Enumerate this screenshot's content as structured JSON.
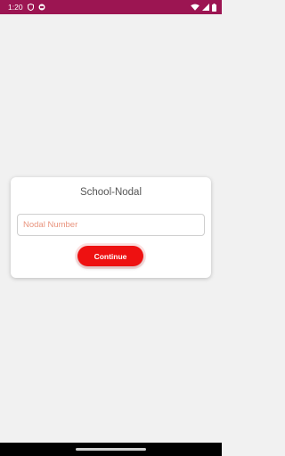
{
  "status_bar": {
    "time": "1:20",
    "left_icons": [
      "shield-icon",
      "notification-app-icon"
    ],
    "right_icons": [
      "wifi-icon",
      "signal-icon",
      "battery-icon"
    ],
    "color": "#9c1552"
  },
  "card": {
    "title": "School-Nodal",
    "input": {
      "placeholder": "Nodal Number",
      "value": ""
    },
    "continue_label": "Continue"
  },
  "colors": {
    "accent": "#ee1111",
    "placeholder": "#e9957f",
    "background": "#f1f1f1"
  }
}
